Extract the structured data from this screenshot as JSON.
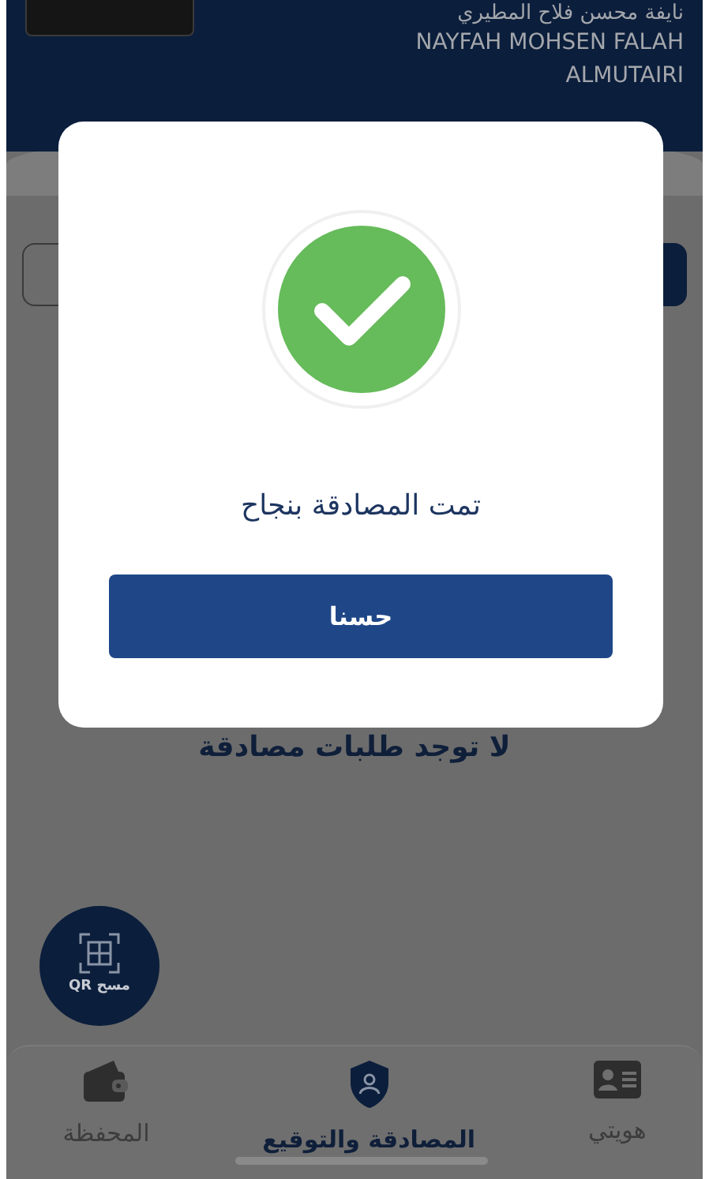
{
  "header": {
    "name_ar": "نايفة محسن فلاح المطيري",
    "name_en": "NAYFAH MOHSEN FALAH ALMUTAIRI"
  },
  "dialog": {
    "message": "تمت المصادقة بنجاح",
    "button": "حسنا"
  },
  "empty_message": "لا توجد طلبات مصادقة",
  "qr_button": {
    "label": "مسح QR"
  },
  "bottom_nav": [
    {
      "label": "هويتي",
      "kind": "id-card",
      "selected": false
    },
    {
      "label": "المصادقة والتوقيع",
      "kind": "shield",
      "selected": true
    },
    {
      "label": "المحفظة",
      "kind": "wallet",
      "selected": false
    }
  ]
}
